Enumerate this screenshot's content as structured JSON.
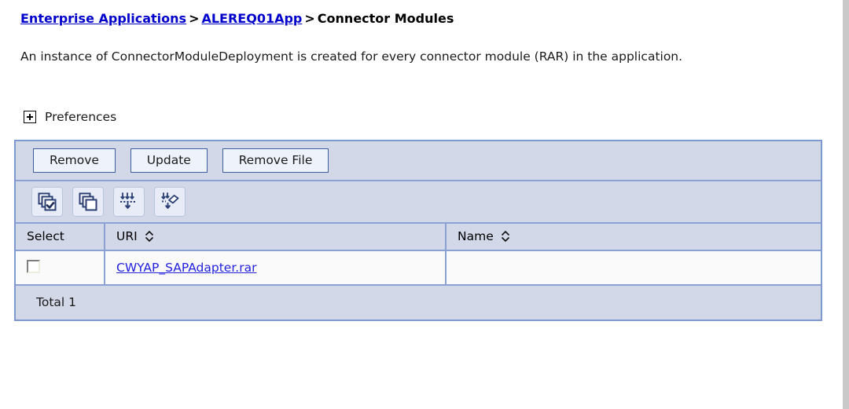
{
  "breadcrumb": {
    "items": [
      {
        "label": "Enterprise Applications",
        "type": "link"
      },
      {
        "label": "ALEREQ01App",
        "type": "link"
      },
      {
        "label": "Connector Modules",
        "type": "current"
      }
    ],
    "separator": ">"
  },
  "description": "An instance of ConnectorModuleDeployment is created for every connector module (RAR) in the application.",
  "preferences": {
    "label": "Preferences",
    "expand_icon": "plus-box-icon",
    "expanded": false
  },
  "toolbar": {
    "buttons": [
      {
        "label": "Remove",
        "name": "remove-button"
      },
      {
        "label": "Update",
        "name": "update-button"
      },
      {
        "label": "Remove File",
        "name": "remove-file-button"
      }
    ]
  },
  "icon_toolbar": {
    "icons": [
      {
        "name": "select-all-icon",
        "title": "Select all items"
      },
      {
        "name": "deselect-all-icon",
        "title": "Deselect all items"
      },
      {
        "name": "show-filter-icon",
        "title": "Show filter function"
      },
      {
        "name": "clear-filter-icon",
        "title": "Clear filter criteria"
      }
    ]
  },
  "table": {
    "columns": [
      {
        "key": "select",
        "label": "Select",
        "sortable": false
      },
      {
        "key": "uri",
        "label": "URI",
        "sortable": true
      },
      {
        "key": "name",
        "label": "Name",
        "sortable": true
      }
    ],
    "rows": [
      {
        "selected": false,
        "uri": "CWYAP_SAPAdapter.rar",
        "name": ""
      }
    ],
    "footer": "Total 1"
  },
  "colors": {
    "link": "#0000cc",
    "table_header_bg": "#d2d8e8",
    "table_border": "#7d99cd",
    "button_border": "#3b5f9e",
    "button_bg": "#eef2fb",
    "row_bg": "#fafafa"
  }
}
